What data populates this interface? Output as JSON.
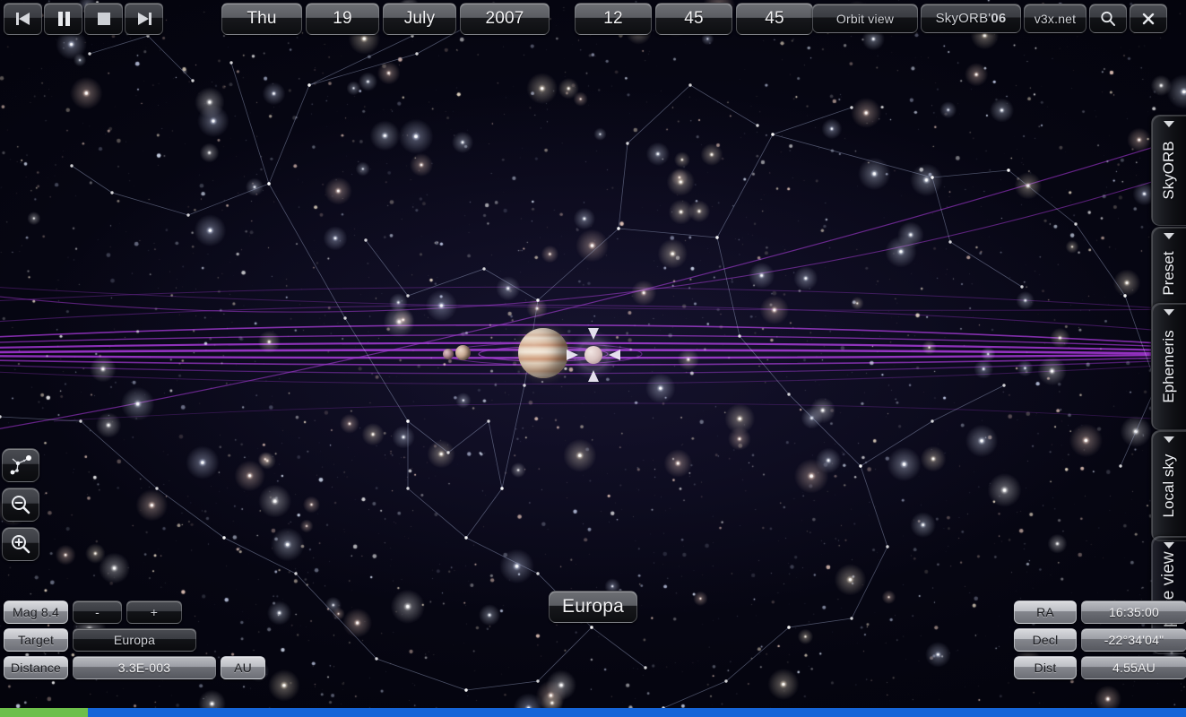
{
  "app": {
    "title": "SkyORB'06",
    "view_mode": "Orbit view",
    "vendor": "v3x.net",
    "brand_year": "06",
    "brand_name": "SkyORB'"
  },
  "topbar": {
    "transport": [
      {
        "name": "step-backward-button",
        "icon": "step-backward-icon",
        "label": ""
      },
      {
        "name": "pause-button",
        "icon": "pause-icon",
        "label": ""
      },
      {
        "name": "stop-button",
        "icon": "stop-icon",
        "label": ""
      },
      {
        "name": "step-forward-button",
        "icon": "step-forward-icon",
        "label": ""
      }
    ],
    "datetime": {
      "weekday": "Thu",
      "day": "19",
      "month": "July",
      "year": "2007"
    },
    "clock": {
      "hours": "12",
      "minutes": "45",
      "seconds": "45"
    },
    "orbit_view_label": "Orbit view",
    "v3x_label": "v3x.net",
    "search_icon": "search-icon",
    "close_icon": "close-icon"
  },
  "left_tools": [
    {
      "name": "constellations-toggle",
      "icon": "constellation-icon"
    },
    {
      "name": "zoom-out-button",
      "icon": "zoom-out-icon"
    },
    {
      "name": "zoom-in-button",
      "icon": "zoom-in-icon"
    }
  ],
  "side_tabs": [
    {
      "label": "SkyORB",
      "name": "tab-skyorb"
    },
    {
      "label": "Preset",
      "name": "tab-preset"
    },
    {
      "label": "Ephemeris",
      "name": "tab-ephemeris"
    },
    {
      "label": "Local sky",
      "name": "tab-localsky"
    },
    {
      "label": "Space view",
      "name": "tab-spaceview"
    }
  ],
  "info_left": {
    "magnitude_label": "Mag 8.4",
    "magnitude_minus": "-",
    "magnitude_plus": "+",
    "target_label": "Target",
    "target_value": "Europa",
    "distance_label": "Distance",
    "distance_value": "3.3E-003",
    "distance_unit": "AU"
  },
  "info_right": {
    "ra_label": "RA",
    "ra_value": "16:35:00",
    "decl_label": "Decl",
    "decl_value": "-22°34'04\"",
    "dist_label": "Dist",
    "dist_value": "4.55AU"
  },
  "scene": {
    "selected_object_label": "Europa",
    "bodies": [
      {
        "name": "jupiter",
        "label": "Jupiter"
      },
      {
        "name": "moon-io",
        "label": "Io"
      },
      {
        "name": "moon-inner",
        "label": "Moon"
      },
      {
        "name": "europa-body",
        "label": "Europa"
      }
    ]
  },
  "colors": {
    "orbit_line": "#9b2fc9",
    "orbit_line_dim": "#5f1d80",
    "constellation_line": "#a9b4d8",
    "status_green": "#6dbf4b",
    "status_blue": "#1565d8",
    "chrome_light": "#c6c8cd",
    "chrome_dark": "#0d0e11"
  }
}
